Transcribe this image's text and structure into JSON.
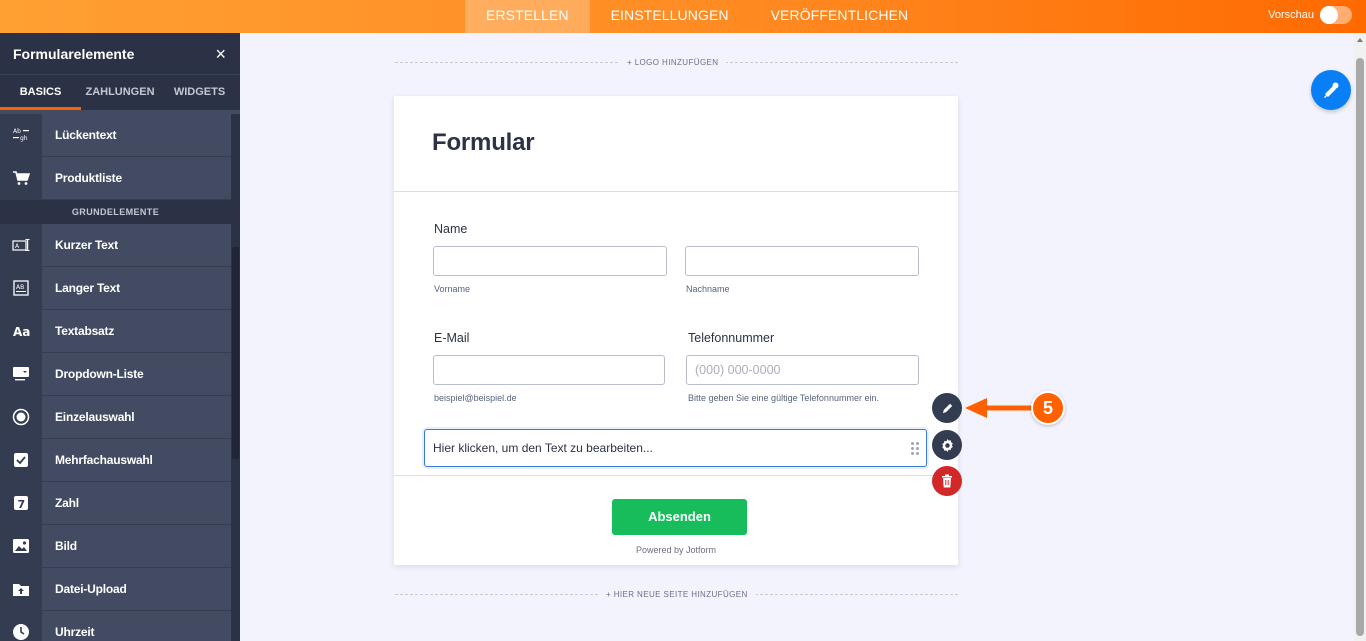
{
  "topbar": {
    "tabs": [
      {
        "label": "ERSTELLEN",
        "active": true
      },
      {
        "label": "EINSTELLUNGEN",
        "active": false
      },
      {
        "label": "VERÖFFENTLICHEN",
        "active": false
      }
    ],
    "preview_label": "Vorschau",
    "preview_on": false
  },
  "sidebar": {
    "title": "Formularelemente",
    "close_label": "×",
    "tabs": [
      {
        "label": "BASICS",
        "active": true
      },
      {
        "label": "ZAHLUNGEN",
        "active": false
      },
      {
        "label": "WIDGETS",
        "active": false
      }
    ],
    "items_top": [
      {
        "label": "Lückentext",
        "icon": "fill-in-blank-icon"
      },
      {
        "label": "Produktliste",
        "icon": "shopping-cart-icon"
      }
    ],
    "section_label": "GRUNDELEMENTE",
    "items": [
      {
        "label": "Kurzer Text",
        "icon": "short-text-icon"
      },
      {
        "label": "Langer Text",
        "icon": "long-text-icon"
      },
      {
        "label": "Textabsatz",
        "icon": "paragraph-icon"
      },
      {
        "label": "Dropdown-Liste",
        "icon": "dropdown-icon"
      },
      {
        "label": "Einzelauswahl",
        "icon": "radio-icon"
      },
      {
        "label": "Mehrfachauswahl",
        "icon": "checkbox-icon"
      },
      {
        "label": "Zahl",
        "icon": "number-icon"
      },
      {
        "label": "Bild",
        "icon": "image-icon"
      },
      {
        "label": "Datei-Upload",
        "icon": "file-upload-icon"
      },
      {
        "label": "Uhrzeit",
        "icon": "clock-icon"
      }
    ]
  },
  "canvas": {
    "add_logo": "+ LOGO HINZUFÜGEN",
    "add_page": "+ HIER NEUE SEITE HINZUFÜGEN"
  },
  "form": {
    "title": "Formular",
    "name_label": "Name",
    "first_name_sub": "Vorname",
    "last_name_sub": "Nachname",
    "first_name_value": "",
    "last_name_value": "",
    "email_label": "E-Mail",
    "email_value": "",
    "email_sub": "beispiel@beispiel.de",
    "phone_label": "Telefonnummer",
    "phone_placeholder": "(000) 000-0000",
    "phone_sub": "Bitte geben Sie eine gültige Telefonnummer ein.",
    "text_element": "Hier klicken, um den Text zu bearbeiten...",
    "submit_label": "Absenden",
    "powered_by": "Powered by Jotform"
  },
  "annotation": {
    "step_number": "5",
    "color": "#ff6100"
  },
  "colors": {
    "accent": "#ff6100",
    "submit": "#18bd5b",
    "sidebar": "#424b61",
    "fab": "#0a7ff5",
    "delete": "#d22828"
  }
}
